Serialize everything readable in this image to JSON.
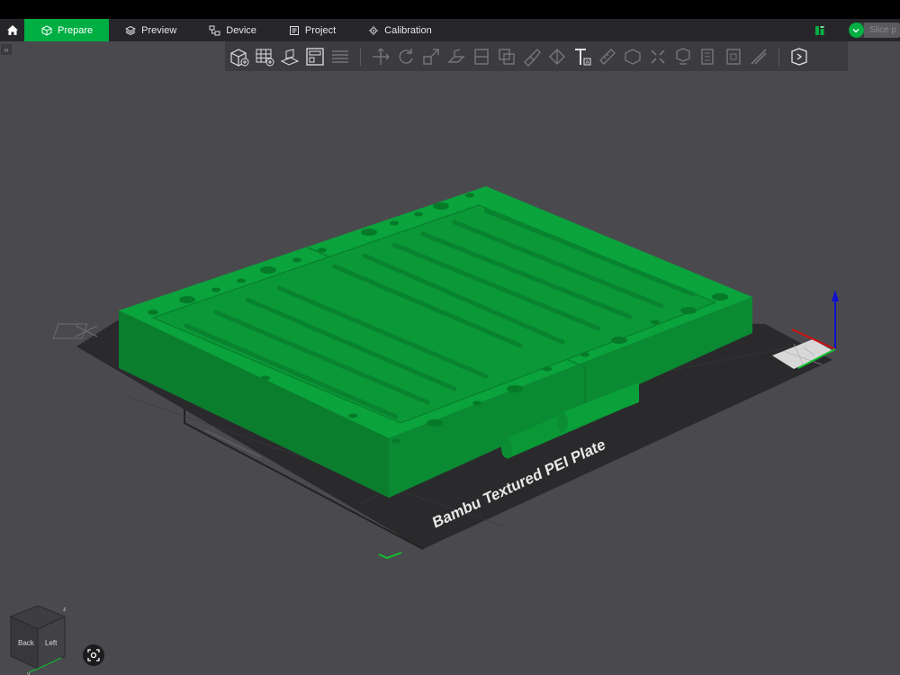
{
  "tabs": [
    {
      "label": "Prepare",
      "icon": "cube-icon",
      "active": true
    },
    {
      "label": "Preview",
      "icon": "layers-icon",
      "active": false
    },
    {
      "label": "Device",
      "icon": "device-icon",
      "active": false
    },
    {
      "label": "Project",
      "icon": "document-icon",
      "active": false
    },
    {
      "label": "Calibration",
      "icon": "calibration-icon",
      "active": false
    }
  ],
  "slice_label": "Slice p",
  "toolbar": {
    "tools": [
      "add-object-icon",
      "arrange-grid-icon",
      "orient-icon",
      "plate-layout-icon",
      "layer-list-icon",
      "move-icon",
      "rotate-icon",
      "scale-icon",
      "lay-on-face-icon",
      "cut-icon",
      "boolean-icon",
      "support-paint-icon",
      "seam-paint-icon",
      "text-emboss-icon",
      "measure-icon",
      "assembly-icon",
      "split-objects-icon",
      "split-parts-icon",
      "variable-height-icon",
      "mesh-repair-icon",
      "brim-ears-icon",
      "more-icon"
    ]
  },
  "plate_label": "Bambu Textured PEI Plate",
  "nav_cube": {
    "faces": [
      "Back",
      "Left"
    ],
    "axis_labels": [
      "z",
      "y"
    ]
  },
  "colors": {
    "accent": "#00ae42",
    "model": "#0a9a3a",
    "bed": "#2a2a2c",
    "viewport": "#4a4a4e"
  }
}
